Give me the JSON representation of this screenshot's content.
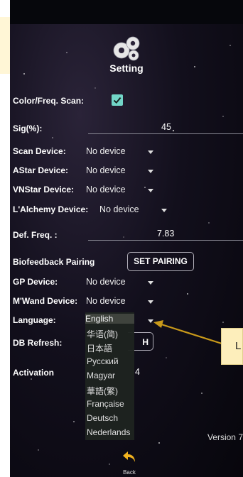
{
  "header": {
    "title": "Setting"
  },
  "settings": {
    "color_scan": {
      "label": "Color/Freq. Scan:",
      "checked": true
    },
    "sig": {
      "label": "Sig(%):",
      "value": "45"
    },
    "scan_device": {
      "label": "Scan Device:",
      "value": "No device"
    },
    "astar_device": {
      "label": "AStar Device:",
      "value": "No device"
    },
    "vnstar_device": {
      "label": "VNStar Device:",
      "value": "No device"
    },
    "lalchemy_device": {
      "label": "L'Alchemy Device:",
      "value": "No device"
    },
    "def_freq": {
      "label": "Def. Freq. :",
      "value": "7.83"
    },
    "biofeedback": {
      "label": "Biofeedback Pairing",
      "button": "SET PAIRING"
    },
    "gp_device": {
      "label": "GP Device:",
      "value": "No device"
    },
    "mwand_device": {
      "label": "M'Wand Device:",
      "value": "No device"
    },
    "language": {
      "label": "Language:",
      "value": "English"
    },
    "db_refresh": {
      "label": "DB Refresh:",
      "button": "H"
    },
    "activation": {
      "label": "Activation",
      "value": "4"
    }
  },
  "language_options": [
    "English",
    "华语(简)",
    "日本語",
    "Русский",
    "Magyar",
    "華語(繁)",
    "Française",
    "Deutsch",
    "Nederlands"
  ],
  "footer": {
    "version": "Version 7",
    "back_label": "Back"
  },
  "callout": {
    "text": "L"
  },
  "colors": {
    "accent_check": "#72d6c8",
    "callout_bg": "#fdeebb",
    "arrow": "#c99a1a"
  },
  "icons": {
    "header": "gears-icon",
    "back": "back-arrow-icon"
  }
}
